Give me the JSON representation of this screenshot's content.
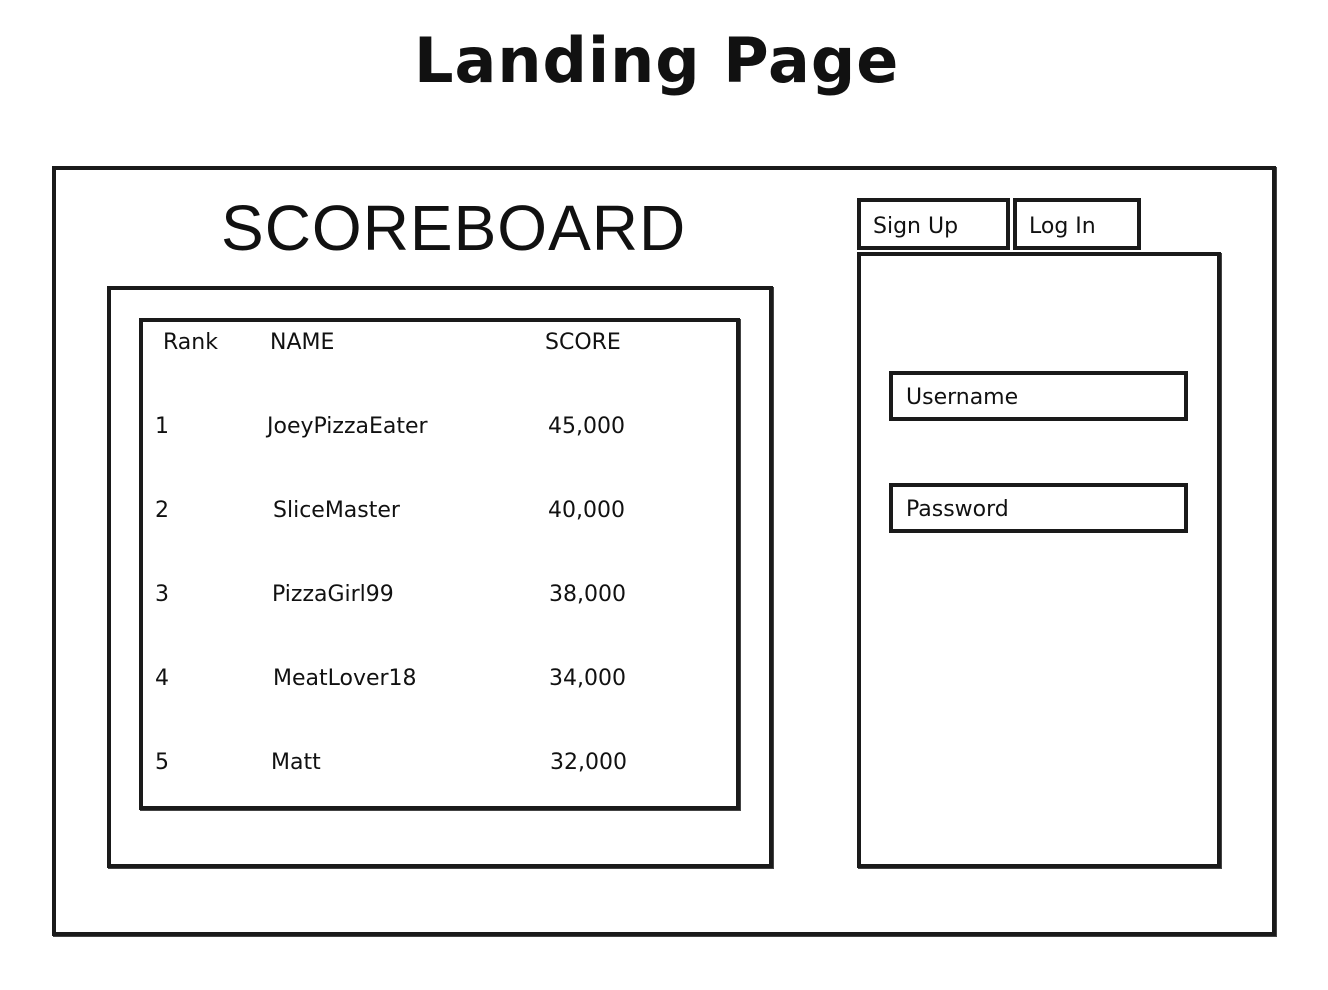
{
  "page_title": "Landing Page",
  "scoreboard": {
    "title": "SCOREBOARD",
    "columns": [
      "Rank",
      "NAME",
      "SCORE"
    ],
    "rows": [
      {
        "rank": "1",
        "name": "JoeyPizzaEater",
        "score": "45,000"
      },
      {
        "rank": "2",
        "name": "SliceMaster",
        "score": "40,000"
      },
      {
        "rank": "3",
        "name": "PizzaGirl99",
        "score": "38,000"
      },
      {
        "rank": "4",
        "name": "MeatLover18",
        "score": "34,000"
      },
      {
        "rank": "5",
        "name": "Matt",
        "score": "32,000"
      }
    ]
  },
  "auth": {
    "tabs": {
      "signup_label": "Sign Up",
      "login_label": "Log In"
    },
    "username_placeholder": "Username",
    "password_placeholder": "Password"
  }
}
